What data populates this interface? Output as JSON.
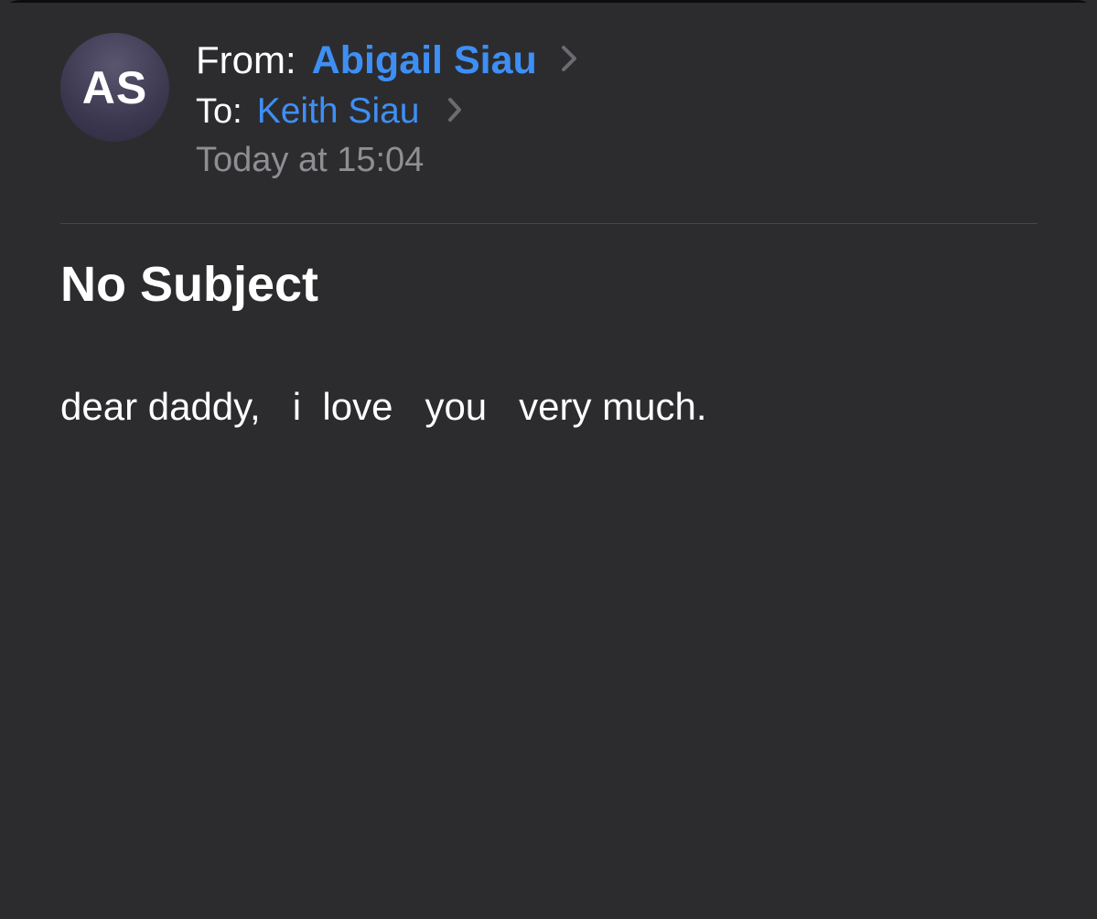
{
  "sender": {
    "initials": "AS",
    "from_label": "From:",
    "from_name": "Abigail Siau",
    "to_label": "To:",
    "to_name": "Keith Siau",
    "timestamp": "Today at 15:04"
  },
  "message": {
    "subject": "No Subject",
    "body": "dear daddy,   i  love   you   very much."
  },
  "colors": {
    "background": "#2c2c2e",
    "link": "#3e8ff5",
    "secondary_text": "#8e8e93",
    "primary_text": "#ffffff"
  },
  "icons": {
    "from_disclosure": "chevron-right-icon",
    "to_disclosure": "chevron-right-icon"
  }
}
